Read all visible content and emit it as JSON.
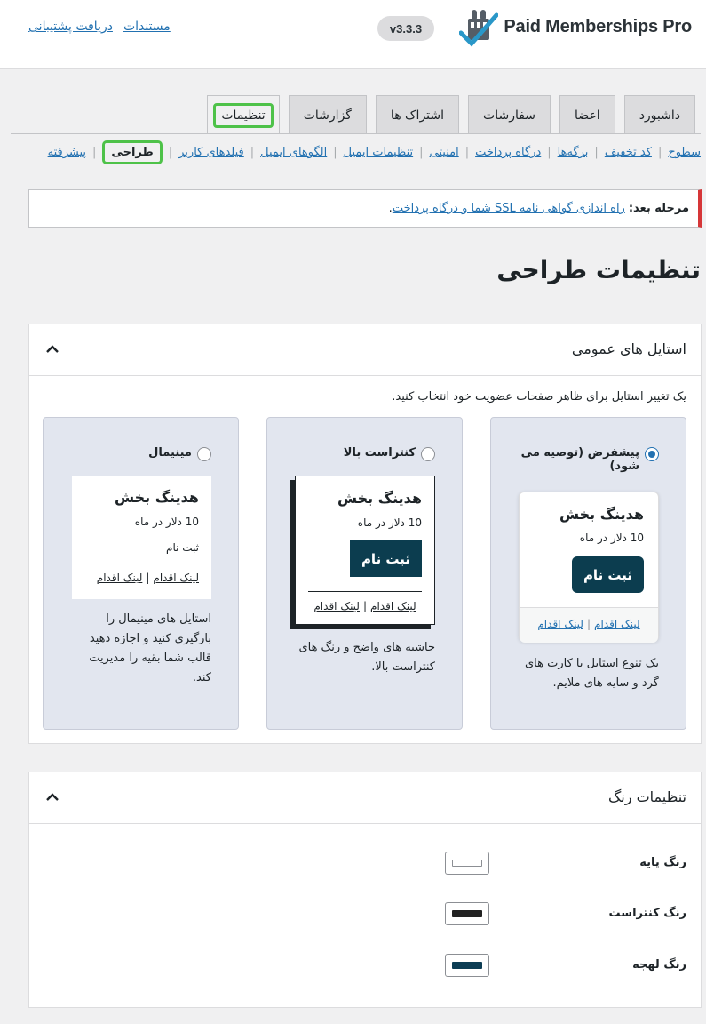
{
  "header": {
    "logo_text": "Paid Memberships Pro",
    "version": "v3.3.3",
    "links": [
      "مستندات",
      "دریافت پشتیبانی"
    ]
  },
  "tabs": [
    "داشبورد",
    "اعضا",
    "سفارشات",
    "اشتراک ها",
    "گزارشات",
    "تنظیمات"
  ],
  "subnav": [
    "سطوح",
    "کد تخفیف",
    "برگه‌ها",
    "درگاه پرداخت",
    "امنیتی",
    "تنظیمات ایمیل",
    "الگوهای ایمیل",
    "فیلدهای کاربر",
    "طراحی",
    "پیشرفته"
  ],
  "notice": {
    "label": "مرحله بعد:",
    "link": "راه اندازی گواهی نامه SSL شما و درگاه پرداخت",
    "end": "."
  },
  "page_title": "تنظیمات طراحی",
  "general_styles": {
    "title": "استایل های عمومی",
    "description": "یک تغییر استایل برای ظاهر صفحات عضویت خود انتخاب کنید.",
    "options": [
      {
        "label": "پیشفرض (توصیه می شود)",
        "selected": true,
        "preview_heading": "هدینگ بخش",
        "preview_price": "10 دلار در ماه",
        "preview_button": "ثبت نام",
        "preview_link": "لینک اقدام",
        "description": "یک تنوع استایل با کارت های گرد و سایه های ملایم."
      },
      {
        "label": "کنتراست بالا",
        "selected": false,
        "preview_heading": "هدینگ بخش",
        "preview_price": "10 دلار در ماه",
        "preview_button": "ثبت نام",
        "preview_link": "لینک اقدام",
        "description": "حاشیه های واضح و رنگ های کنتراست بالا."
      },
      {
        "label": "مینیمال",
        "selected": false,
        "preview_heading": "هدینگ بخش",
        "preview_price": "10 دلار در ماه",
        "preview_button": "ثبت نام",
        "preview_link": "لینک اقدام",
        "description": "استایل های مینیمال را بارگیری کنید و اجازه دهید قالب شما بقیه را مدیریت کند."
      }
    ]
  },
  "color_settings": {
    "title": "تنظیمات رنگ",
    "rows": [
      {
        "label": "رنگ پایه",
        "color": "#ffffff"
      },
      {
        "label": "رنگ کنتراست",
        "color": "#222222"
      },
      {
        "label": "رنگ لهجه",
        "color": "#0c3d54"
      }
    ]
  },
  "colors": {
    "accent_green": "#4ec249",
    "link": "#2271b1",
    "notice_red": "#d63638",
    "button_dark": "#0c3d4f"
  }
}
